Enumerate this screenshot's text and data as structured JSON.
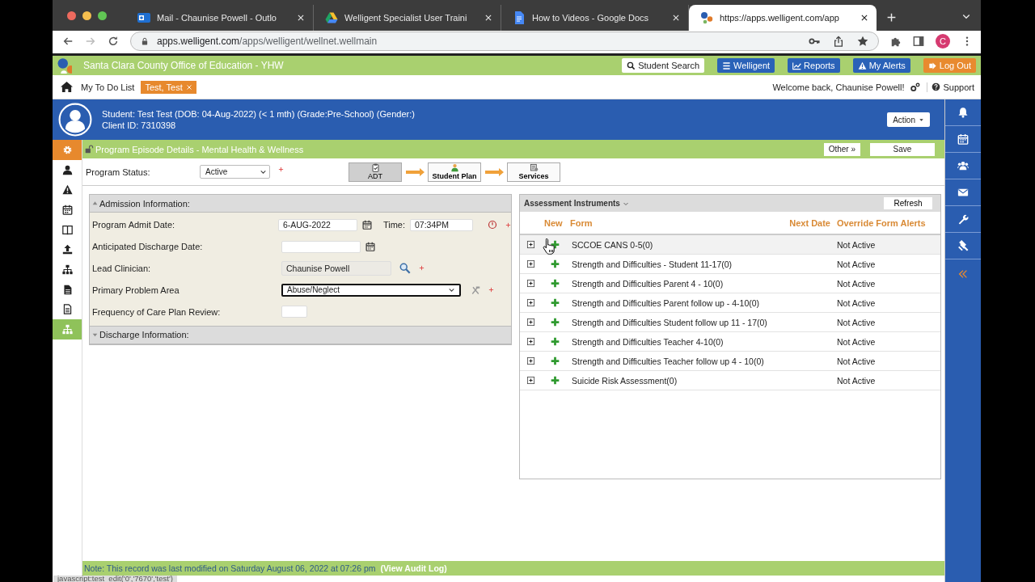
{
  "browser": {
    "tabs": [
      {
        "title": "Mail - Chaunise Powell - Outlo",
        "kind": "mail",
        "selected": false
      },
      {
        "title": "Welligent Specialist User Traini",
        "kind": "drive",
        "selected": false
      },
      {
        "title": "How to Videos - Google Docs",
        "kind": "doc",
        "selected": false
      },
      {
        "title": "https://apps.welligent.com/app",
        "kind": "app",
        "selected": true
      }
    ],
    "url_host": "apps.welligent.com",
    "url_path": "/apps/welligent/wellnet.wellmain",
    "profile_initial": "C"
  },
  "app": {
    "title": "Santa Clara County Office of Education - YHW",
    "header_buttons": [
      {
        "label": "Student Search",
        "kind": "search"
      },
      {
        "label": "Welligent",
        "kind": "menu"
      },
      {
        "label": "Reports",
        "kind": "chart"
      },
      {
        "label": "My Alerts",
        "kind": "alert"
      },
      {
        "label": "Log Out",
        "kind": "logout"
      }
    ]
  },
  "nav": {
    "links": [
      {
        "label": "My To Do List",
        "kind": "link"
      },
      {
        "label": "Test, Test",
        "kind": "tag"
      }
    ],
    "welcome": "Welcome back, Chaunise Powell!",
    "support": "Support"
  },
  "student": {
    "line": "Student: Test Test (DOB: 04-Aug-2022) (< 1 mth) (Grade:Pre-School) (Gender:)",
    "client_id": "Client ID: 7310398",
    "action": "Action"
  },
  "left_sidebar": {
    "items": [
      {
        "kind": "gear",
        "selected": false
      },
      {
        "kind": "person",
        "selected": false
      },
      {
        "kind": "warning",
        "selected": false
      },
      {
        "kind": "calendar",
        "selected": false
      },
      {
        "kind": "book",
        "selected": false
      },
      {
        "kind": "upload",
        "selected": false
      },
      {
        "kind": "sitemap",
        "selected": false
      },
      {
        "kind": "file",
        "selected": false
      },
      {
        "kind": "doc",
        "selected": false
      },
      {
        "kind": "sitemap",
        "selected": true
      }
    ]
  },
  "right_sidebar": {
    "items": [
      {
        "kind": "bell"
      },
      {
        "kind": "calendar"
      },
      {
        "kind": "users"
      },
      {
        "kind": "mail"
      },
      {
        "kind": "wrench"
      },
      {
        "kind": "gavel"
      },
      {
        "kind": "collapse"
      }
    ]
  },
  "episode": {
    "title": "Program Episode Details - Mental Health & Wellness",
    "buttons": [
      "Other »",
      "Save"
    ],
    "status_label": "Program Status:",
    "status_value": "Active",
    "status_required": true,
    "steps": [
      {
        "label": "ADT",
        "kind": "clipboard",
        "selected": true
      },
      {
        "label": "Student Plan",
        "kind": "person",
        "selected": false
      },
      {
        "label": "Services",
        "kind": "services",
        "selected": false
      }
    ]
  },
  "admission": {
    "title": "Admission Information:",
    "expanded": true,
    "fields": [
      {
        "label": "Program Admit Date:",
        "kind": "date",
        "value": "6-AUG-2022",
        "time_label": "Time:",
        "time_value": "07:34PM",
        "required": true
      },
      {
        "label": "Anticipated Discharge Date:",
        "kind": "date",
        "required": false
      },
      {
        "label": "Lead Clinician:",
        "kind": "lookup",
        "value": "Chaunise Powell",
        "required": true
      },
      {
        "label": "Primary Problem Area",
        "kind": "select",
        "value": "Abuse/Neglect",
        "required": true
      },
      {
        "label": "Frequency of Care Plan Review:",
        "kind": "small",
        "required": false
      }
    ]
  },
  "discharge": {
    "title": "Discharge Information:",
    "expanded": false
  },
  "assessments": {
    "title": "Assessment Instruments",
    "refresh": "Refresh",
    "columns": [
      "New",
      "Form",
      "Next Date",
      "Override Form Alerts"
    ],
    "rows": [
      {
        "form": "SCCOE CANS 0-5(0)",
        "override": "Not Active",
        "hovered": true
      },
      {
        "form": "Strength and Difficulties - Student 11-17(0)",
        "override": "Not Active",
        "hovered": false
      },
      {
        "form": "Strength and Difficulties Parent 4 - 10(0)",
        "override": "Not Active",
        "hovered": false
      },
      {
        "form": "Strength and Difficulties Parent follow up - 4-10(0)",
        "override": "Not Active",
        "hovered": false
      },
      {
        "form": "Strength and Difficulties Student follow up 11 - 17(0)",
        "override": "Not Active",
        "hovered": false
      },
      {
        "form": "Strength and Difficulties Teacher 4-10(0)",
        "override": "Not Active",
        "hovered": false
      },
      {
        "form": "Strength and Difficulties Teacher follow up 4 - 10(0)",
        "override": "Not Active",
        "hovered": false
      },
      {
        "form": "Suicide Risk Assessment(0)",
        "override": "Not Active",
        "hovered": false
      }
    ]
  },
  "footer": {
    "note": "Note: This record was last modified on Saturday August 06, 2022 at 07:26 pm",
    "audit_link": "(View Audit Log)"
  },
  "status_url": "javascript:test_edit('0','7670','test')"
}
